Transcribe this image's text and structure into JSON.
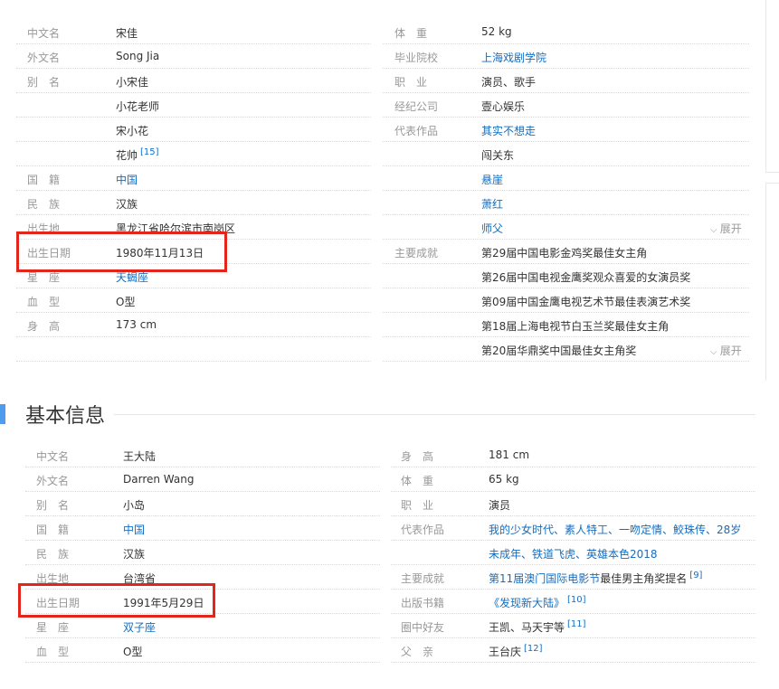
{
  "person1": {
    "left_rows": [
      {
        "label": "中文名",
        "value": "宋佳"
      },
      {
        "label": "外文名",
        "value": "Song Jia"
      },
      {
        "label": "别　名",
        "value": "小宋佳"
      },
      {
        "label": "",
        "value": "小花老师"
      },
      {
        "label": "",
        "value": "宋小花"
      },
      {
        "label": "",
        "value": "花帅",
        "ref": "[15]"
      },
      {
        "label": "国　籍",
        "value": "中国",
        "link": true
      },
      {
        "label": "民　族",
        "value": "汉族"
      },
      {
        "label": "出生地",
        "value": "黑龙江省哈尔滨市南岗区"
      },
      {
        "label": "出生日期",
        "value": "1980年11月13日"
      },
      {
        "label": "星　座",
        "value": "天蝎座",
        "link": true
      },
      {
        "label": "血　型",
        "value": "O型"
      },
      {
        "label": "身　高",
        "value": "173 cm"
      },
      {
        "label": "",
        "value": ""
      }
    ],
    "right_rows": [
      {
        "label": "体　重",
        "value": "52 kg"
      },
      {
        "label": "毕业院校",
        "value": "上海戏剧学院",
        "link": true
      },
      {
        "label": "职　业",
        "value": "演员、歌手"
      },
      {
        "label": "经纪公司",
        "value": "壹心娱乐"
      },
      {
        "label": "代表作品",
        "value": "其实不想走",
        "link": true
      },
      {
        "label": "",
        "value": "闯关东"
      },
      {
        "label": "",
        "value": "悬崖",
        "link": true
      },
      {
        "label": "",
        "value": "萧红",
        "link": true
      },
      {
        "label": "",
        "value": "师父",
        "link": true,
        "expand": "展开"
      },
      {
        "label": "主要成就",
        "value": "第29届中国电影金鸡奖最佳女主角"
      },
      {
        "label": "",
        "value": "第26届中国电视金鹰奖观众喜爱的女演员奖"
      },
      {
        "label": "",
        "value": "第09届中国金鹰电视艺术节最佳表演艺术奖"
      },
      {
        "label": "",
        "value": "第18届上海电视节白玉兰奖最佳女主角"
      },
      {
        "label": "",
        "value": "第20届华鼎奖中国最佳女主角奖",
        "expand": "展开"
      }
    ]
  },
  "section": {
    "title": "基本信息"
  },
  "person2": {
    "left_rows": [
      {
        "label": "中文名",
        "value": "王大陆"
      },
      {
        "label": "外文名",
        "value": "Darren Wang"
      },
      {
        "label": "别　名",
        "value": "小岛"
      },
      {
        "label": "国　籍",
        "value": "中国",
        "link": true
      },
      {
        "label": "民　族",
        "value": "汉族"
      },
      {
        "label": "出生地",
        "value": "台湾省"
      },
      {
        "label": "出生日期",
        "value": "1991年5月29日"
      },
      {
        "label": "星　座",
        "value": "双子座",
        "link": true
      },
      {
        "label": "血　型",
        "value": "O型"
      }
    ],
    "right_rows": [
      {
        "label": "身　高",
        "value": "181 cm"
      },
      {
        "label": "体　重",
        "value": "65 kg"
      },
      {
        "label": "职　业",
        "value": "演员"
      },
      {
        "label": "代表作品",
        "value": "我的少女时代、素人特工、一吻定情、鮫珠传、28岁",
        "link": true
      },
      {
        "label": "",
        "value": "未成年、铁道飞虎、英雄本色2018",
        "link": true
      },
      {
        "label": "主要成就",
        "value_link": "第11届澳门国际电影节",
        "value_rest": "最佳男主角奖提名",
        "ref": "[9]"
      },
      {
        "label": "出版书籍",
        "value": "《发现新大陆》",
        "link": true,
        "ref": "[10]"
      },
      {
        "label": "圈中好友",
        "value": "王凯、马天宇等",
        "ref": "[11]"
      },
      {
        "label": "父　亲",
        "value": "王台庆",
        "ref": "[12]"
      }
    ]
  },
  "colors": {
    "link": "#136ec2",
    "highlight": "#e2261b",
    "accent": "#4f9cee"
  }
}
